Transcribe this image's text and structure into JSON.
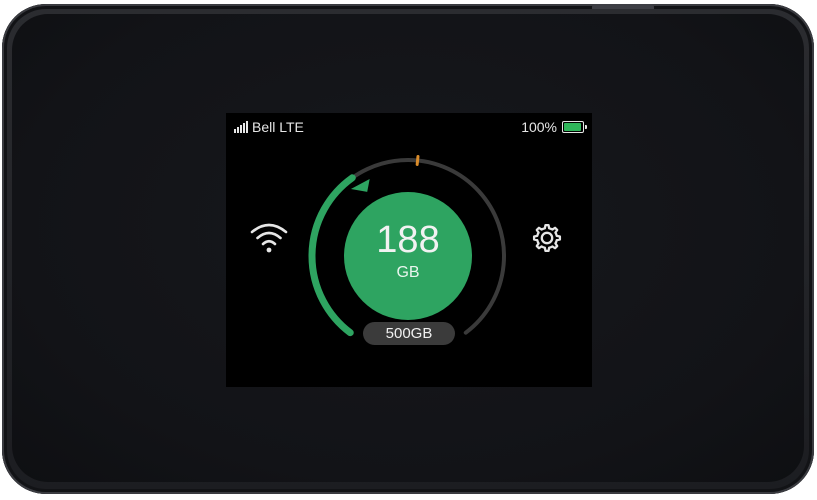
{
  "status_bar": {
    "carrier": "Bell LTE",
    "signal_icon": "signal-bars-icon",
    "battery_percent": "100%",
    "battery_level": 1.0,
    "battery_color": "#2fb65a"
  },
  "usage": {
    "value": "188",
    "unit": "GB",
    "plan_label": "500GB",
    "used_fraction": 0.376,
    "marker_fraction": 0.52,
    "accent_color": "#2ea461",
    "marker_color": "#d98c2b"
  },
  "icons": {
    "left": "wifi-icon",
    "right": "gear-icon"
  }
}
